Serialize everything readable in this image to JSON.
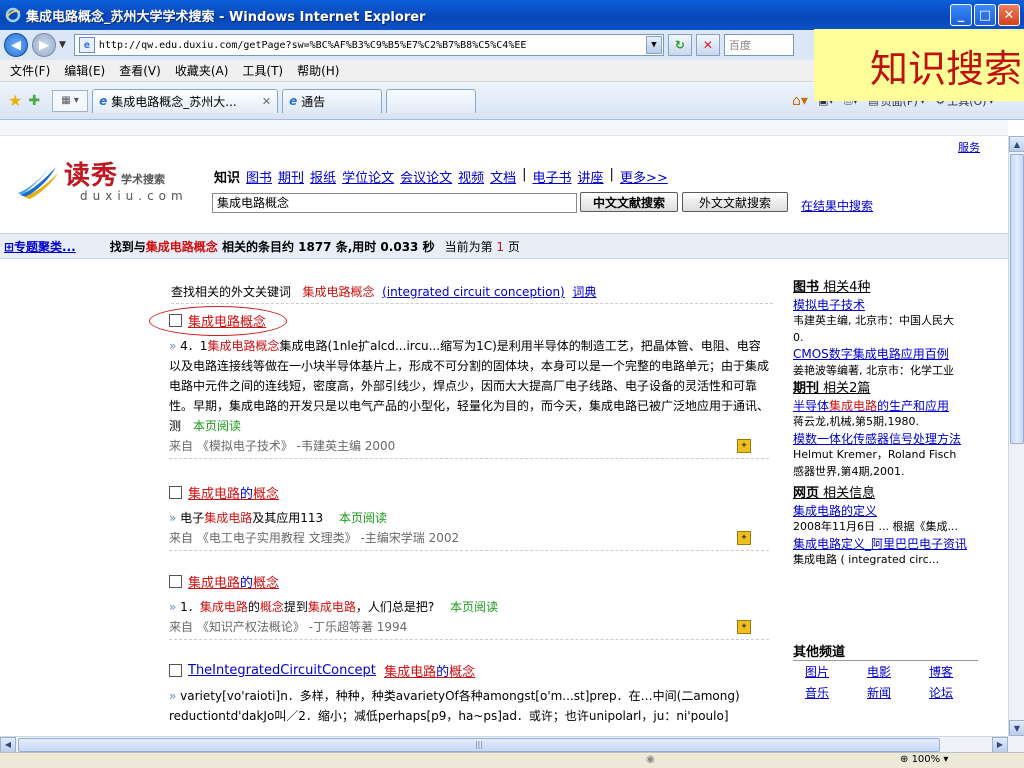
{
  "window": {
    "title": "集成电路概念_苏州大学学术搜索 - Windows Internet Explorer",
    "minimize": "_",
    "maximize": "□",
    "close": "✕"
  },
  "address": {
    "url": "http://qw.edu.duxiu.com/getPage?sw=%BC%AF%B3%C9%B5%E7%C2%B7%B8%C5%C4%EE",
    "search_placeholder": "百度"
  },
  "menu": [
    "文件(F)",
    "编辑(E)",
    "查看(V)",
    "收藏夹(A)",
    "工具(T)",
    "帮助(H)"
  ],
  "tabs": [
    {
      "label": "集成电路概念_苏州大...",
      "close": "✕"
    },
    {
      "label": "通告"
    }
  ],
  "commandbar": {
    "page": "页面(P)",
    "tools": "工具(O)"
  },
  "overlay_label": "知识搜索",
  "top_link": "服务",
  "logo": {
    "brand": "读秀",
    "sub": "学术搜索",
    "en": "duxiu.com"
  },
  "channels": {
    "active": "知识",
    "items": [
      "图书",
      "期刊",
      "报纸",
      "学位论文",
      "会议论文",
      "视频",
      "文档"
    ],
    "items2": [
      "电子书",
      "讲座"
    ],
    "more": "更多>>"
  },
  "search": {
    "query": "集成电路概念",
    "btn_cn": "中文文献搜索",
    "btn_en": "外文文献搜索",
    "within": "在结果中搜索"
  },
  "resultbar": {
    "topics": "⊞专题聚类...",
    "prefix": "找到与",
    "keyword": "集成电路概念",
    "middle": " 相关的条目约 1877 条,用时 0.033 秒",
    "page_prefix": "当前为第 ",
    "page_num": "1",
    "page_suffix": " 页"
  },
  "keywords": {
    "label": "查找相关的外文关键词",
    "kw": "集成电路概念",
    "en": "(integrated circuit conception)",
    "dict": "词典"
  },
  "results": [
    {
      "title": "集成电路概念",
      "body_html": "<span class='arrow'>»</span> 4．1<span class='red'>集成电路概念</span>集成电路(1nle扩alcd...ircu...缩写为1C)是利用半导体的制造工艺，把晶体管、电阻、电容以及电路连接线等做在一小块半导体基片上，形成不可分割的固体块，本身可以是一个完整的电路单元；由于集成电路中元件之间的连线短，密度高，外部引线少，焊点少，因而大大提高厂电子线路、电子设备的灵活性和可靠性。早期，集成电路的开发只是以电气产品的小型化，轻量化为目的，而今天，集成电路已被广泛地应用于通讯、测",
      "read": "本页阅读",
      "source": "来自 《模拟电子技术》 -韦建英主编 2000"
    },
    {
      "title_a": "集成电路",
      "title_b": "的",
      "title_c": "概念",
      "body_pre": "电子",
      "body_red": "集成电路",
      "body_post": "及其应用113",
      "read": "本页阅读",
      "source": "来自 《电工电子实用教程 文理类》 -主编宋学瑞 2002"
    },
    {
      "title_a": "集成电路",
      "title_b": "的",
      "title_c": "概念",
      "body_pre": "1．",
      "body_red": "集成电路",
      "body_mid": "的",
      "body_red2": "概念",
      "body_mid2": "提到",
      "body_red3": "集成电路",
      "body_post": "，人们总是把?",
      "read": "本页阅读",
      "source": "来自 《知识产权法概论》 -丁乐超等著 1994"
    },
    {
      "title_en": "TheIntegratedCircuitConcept",
      "title_a": "集成电路",
      "title_b": "的",
      "title_c": "概念",
      "body1": "variety[vo'raioti]n．多样，种种，种类avarietyOf各种amongst[o'm...st]prep．在…中间(二among)",
      "body2": "reductiontd'dakJo叫／2．缩小；减低perhaps[p9，ha~ps]ad．或许；也许unipolarl，ju：ni'poulo]"
    }
  ],
  "sidebar": {
    "books": {
      "head": "图书",
      "count": " 相关4种",
      "items": [
        {
          "link": "模拟电子技术",
          "desc": "韦建英主编, 北京市：中国人民大"
        },
        {
          "link": "0.",
          "desc": ""
        },
        {
          "link": "CMOS数字集成电路应用百例",
          "desc": "姜艳波等编著, 北京市：化学工业"
        }
      ]
    },
    "journals": {
      "head": "期刊",
      "count": " 相关2篇",
      "items": [
        {
          "link_a": "半导体",
          "link_red": "集成电路",
          "link_b": "的生产和应用",
          "desc": "蒋云龙,机械,第5期,1980."
        },
        {
          "link": "模数一体化传感器信号处理方法",
          "desc": "Helmut Kremer，Roland Fisch",
          "desc2": "感器世界,第4期,2001."
        }
      ]
    },
    "web": {
      "head": "网页",
      "count": " 相关信息",
      "items": [
        {
          "link": "集成电路的定义",
          "desc": "2008年11月6日 ... 根据《集成..."
        },
        {
          "link": "集成电路定义_阿里巴巴电子资讯",
          "desc": "集成电路 ( integrated circ..."
        }
      ]
    }
  },
  "other": {
    "head": "其他频道",
    "items": [
      "图片",
      "电影",
      "博客",
      "音乐",
      "新闻",
      "论坛"
    ]
  },
  "status": {
    "zoom": "100%"
  }
}
